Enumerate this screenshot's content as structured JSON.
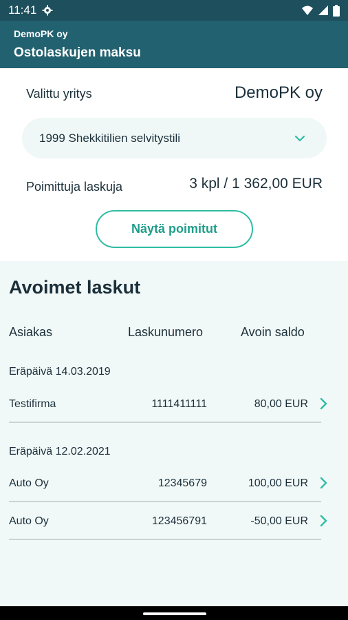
{
  "status_bar": {
    "time": "11:41"
  },
  "app_bar": {
    "subtitle": "DemoPK oy",
    "title": "Ostolaskujen maksu"
  },
  "company": {
    "label": "Valittu yritys",
    "value": "DemoPK oy"
  },
  "account": {
    "selected": "1999 Shekkitilien selvitystili"
  },
  "selected_invoices": {
    "label": "Poimittuja laskuja",
    "value": "3 kpl / 1 362,00 EUR"
  },
  "show_selected_button": "Näytä poimitut",
  "open_invoices": {
    "title": "Avoimet laskut",
    "columns": {
      "customer": "Asiakas",
      "invoice_number": "Laskunumero",
      "balance": "Avoin saldo"
    },
    "groups": [
      {
        "due_label": "Eräpäivä 14.03.2019",
        "rows": [
          {
            "customer": "Testifirma",
            "number": "1111411111",
            "amount": "80,00 EUR"
          }
        ]
      },
      {
        "due_label": "Eräpäivä 12.02.2021",
        "rows": [
          {
            "customer": "Auto Oy",
            "number": "12345679",
            "amount": "100,00 EUR"
          },
          {
            "customer": "Auto Oy",
            "number": "123456791",
            "amount": "-50,00 EUR"
          }
        ]
      }
    ]
  },
  "colors": {
    "app_bar": "#22616f",
    "status_bar": "#1e4f5c",
    "accent": "#2ebca3",
    "background": "#f1f9f8"
  }
}
